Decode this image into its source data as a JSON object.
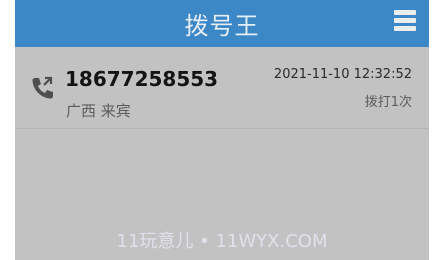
{
  "header": {
    "title": "拨号王",
    "menu_icon": "hamburger-menu-icon"
  },
  "call_log": [
    {
      "icon": "phone-call-icon",
      "number": "18677258553",
      "location": "广西 来宾",
      "datetime": "2021-11-10 12:32:52",
      "count_label": "拨打1次"
    }
  ],
  "watermark": "11玩意儿 • 11WYX.COM",
  "colors": {
    "header_bg": "#3c88c7",
    "content_bg": "#c2c2c2"
  }
}
